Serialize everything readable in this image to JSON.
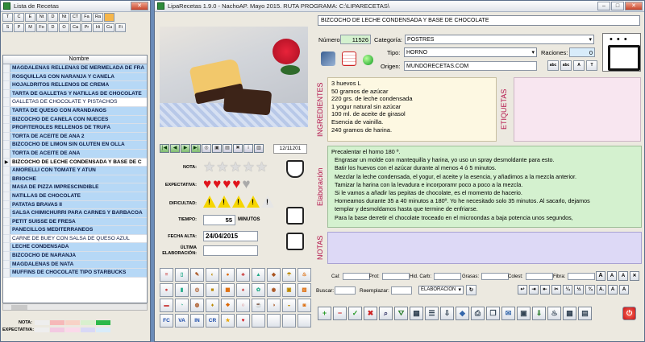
{
  "left": {
    "title": "Lista de Recetas",
    "letters_row1": [
      "T",
      "C",
      "E",
      "Nt",
      "D",
      "Nt",
      "CT",
      "Fa",
      "Ra",
      ""
    ],
    "letters_row2": [
      "S",
      "P",
      "M",
      "Fo",
      "D",
      "O",
      "Ca",
      "Pr",
      "Hi",
      "Cu",
      "Fi"
    ],
    "column_header": "Nombre",
    "rows": [
      {
        "text": "MAGDALENAS RELLENAS DE MERMELADA DE FRA",
        "style": "blue"
      },
      {
        "text": "ROSQUILLAS CON NARANJA Y CANELA",
        "style": "blue"
      },
      {
        "text": "HOJALDRITOS RELLENOS DE CREMA",
        "style": "blue"
      },
      {
        "text": "TARTA DE GALLETAS Y NATILLAS DE CHOCOLATE",
        "style": "blue"
      },
      {
        "text": "GALLETAS DE CHOCOLATE Y PISTACHOS",
        "style": "white"
      },
      {
        "text": "TARTA DE QUESO CON ARANDANOS",
        "style": "blue"
      },
      {
        "text": "BIZCOCHO DE CANELA CON NUECES",
        "style": "blue"
      },
      {
        "text": "PROFITEROLES RELLENOS DE TRUFA",
        "style": "blue"
      },
      {
        "text": "TORTA DE ACEITE DE ANA 2",
        "style": "blue"
      },
      {
        "text": "BIZCOCHO DE LIMON SIN GLUTEN EN OLLA",
        "style": "blue"
      },
      {
        "text": "TORTA DE ACEITE DE ANA",
        "style": "blue"
      },
      {
        "text": "BIZCOCHO DE LECHE CONDENSADA Y BASE DE C",
        "style": "selected"
      },
      {
        "text": "AMORELLI CON TOMATE Y ATUN",
        "style": "blue"
      },
      {
        "text": "BRIOCHE",
        "style": "blue"
      },
      {
        "text": "MASA DE PIZZA IMPRESCINDIBLE",
        "style": "blue"
      },
      {
        "text": "NATILLAS DE CHOCOLATE",
        "style": "blue"
      },
      {
        "text": "PATATAS BRAVAS II",
        "style": "blue"
      },
      {
        "text": "SALSA CHIMICHURRI PARA CARNES Y BARBACOA",
        "style": "blue"
      },
      {
        "text": "PETIT SUISSE DE FRESA",
        "style": "blue"
      },
      {
        "text": "PANECILLOS MEDITERRANEOS",
        "style": "blue"
      },
      {
        "text": "CARNE DE BUEY CON SALSA DE QUESO AZUL",
        "style": "white"
      },
      {
        "text": "LECHE CONDENSADA",
        "style": "blue"
      },
      {
        "text": "BIZCOCHO DE NARANJA",
        "style": "blue"
      },
      {
        "text": "MAGDALENAS DE NATA",
        "style": "blue"
      },
      {
        "text": "MUFFINS DE CHOCOLATE TIPO STARBUCKS",
        "style": "blue"
      }
    ],
    "legend_nota": "NOTA:",
    "legend_exp": "EXPECTATIVA:"
  },
  "right": {
    "title": "LipaRecetas 1.9.0 - NachoAP. Mayo 2015. RUTA PROGRAMA: C:\\LIPARECETAS\\",
    "recipe_title": "BIZCOCHO DE LECHE CONDENSADA Y BASE DE CHOCOLATE",
    "numero_label": "Número:",
    "numero": "11526",
    "categoria_label": "Categoría:",
    "categoria": "POSTRES",
    "tipo_label": "Tipo:",
    "tipo": "HORNO",
    "raciones_label": "Raciones:",
    "raciones": "0",
    "origen_label": "Origen:",
    "origen": "MUNDORECETAS.COM",
    "counter": "12/11201",
    "nota_label": "NOTA:",
    "expectativa_label": "EXPECTATIVA:",
    "dificultad_label": "DIFICULTAD:",
    "tiempo_label": "TIEMPO:",
    "tiempo": "55",
    "minutos_label": "MINUTOS",
    "fecha_label": "FECHA ALTA:",
    "fecha": "24/04/2015",
    "ultima_label": "ÚLTIMA ELABORACIÓN:",
    "ingredientes_label": "INGREDIENTES",
    "ingredientes": [
      "3 huevos L",
      "50 gramos de azúcar",
      "220 grs. de leche condensada",
      "1 yogur natural sin azúcar",
      "100 ml. de aceite de girasol",
      "Esencia de vainilla.",
      "240 gramos de harina."
    ],
    "etiquetas_label": "ETIQUETAS",
    "elaboracion_label": "Elaboración",
    "elaboracion": [
      "Precalentar el horno 180 º.",
      "Engrasar un molde con mantequilla y harina, yo uso un spray desmoldante para esto.",
      "Batir los huevos con el azúcar durante al menos 4 ó 5 minutos.",
      "Mezclar la leche condensada, el yogur, el aceite y la esencia, y añadimos a la mezcla anterior.",
      "Tamizar la harina con la levadura e incorporamr poco a poco a la mezcla.",
      "Si le vamos a añadir las pepitas de chocolate, es el momento de hacerio.",
      "Horneamos durante 35 a 40 minutos a 180º. Yo he necesitado solo 35 minutos. Al sacarlo, dejamos",
      "templar y desmoldamos hasta que termine de enfriarse.",
      "Para la base derretir el chocolate troceado en el microondas a baja potencia unos segundos,"
    ],
    "notas_label": "NOTAS",
    "cal_label": "Cal:",
    "prot_label": "Prot:",
    "hid_label": "Hid. Carb:",
    "grasas_label": "Grasas:",
    "colest_label": "Colest:",
    "fibra_label": "Fibra:",
    "buscar_label": "Buscar:",
    "reemplazar_label": "Reemplazar:",
    "campo": "ELABORACION",
    "icon_labels": [
      "FC",
      "VA",
      "IN",
      "CR"
    ]
  },
  "colors": {
    "accent_blue": "#b6d8f6",
    "green_box": "#d4f1cf",
    "pink_box": "#f8e6f0",
    "lilac_box": "#ddd9f6",
    "yellow_box": "#fdf8e2"
  }
}
